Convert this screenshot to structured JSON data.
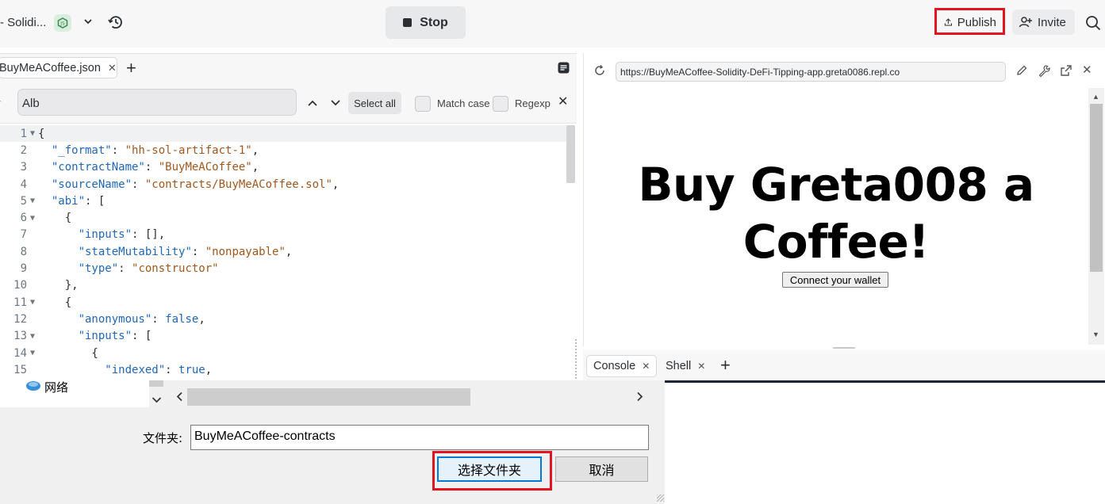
{
  "topbar": {
    "project_title": "- Solidi...",
    "stop_label": "Stop",
    "publish_label": "Publish",
    "invite_label": "Invite"
  },
  "editor": {
    "tab_label": "BuyMeACoffee.json",
    "find_value": "Alb",
    "select_all_label": "Select all",
    "match_case_label": "Match case",
    "regexp_label": "Regexp",
    "lines": [
      {
        "n": "1",
        "fold": true,
        "tokens": [
          [
            "p",
            "{"
          ]
        ]
      },
      {
        "n": "2",
        "fold": false,
        "tokens": [
          [
            "p",
            "  "
          ],
          [
            "key",
            "\"_format\""
          ],
          [
            "p",
            ": "
          ],
          [
            "str",
            "\"hh-sol-artifact-1\""
          ],
          [
            "p",
            ","
          ]
        ]
      },
      {
        "n": "3",
        "fold": false,
        "tokens": [
          [
            "p",
            "  "
          ],
          [
            "key",
            "\"contractName\""
          ],
          [
            "p",
            ": "
          ],
          [
            "str",
            "\"BuyMeACoffee\""
          ],
          [
            "p",
            ","
          ]
        ]
      },
      {
        "n": "4",
        "fold": false,
        "tokens": [
          [
            "p",
            "  "
          ],
          [
            "key",
            "\"sourceName\""
          ],
          [
            "p",
            ": "
          ],
          [
            "str",
            "\"contracts/BuyMeACoffee.sol\""
          ],
          [
            "p",
            ","
          ]
        ]
      },
      {
        "n": "5",
        "fold": true,
        "tokens": [
          [
            "p",
            "  "
          ],
          [
            "key",
            "\"abi\""
          ],
          [
            "p",
            ": ["
          ]
        ]
      },
      {
        "n": "6",
        "fold": true,
        "tokens": [
          [
            "p",
            "    {"
          ]
        ]
      },
      {
        "n": "7",
        "fold": false,
        "tokens": [
          [
            "p",
            "      "
          ],
          [
            "key",
            "\"inputs\""
          ],
          [
            "p",
            ": [],"
          ]
        ]
      },
      {
        "n": "8",
        "fold": false,
        "tokens": [
          [
            "p",
            "      "
          ],
          [
            "key",
            "\"stateMutability\""
          ],
          [
            "p",
            ": "
          ],
          [
            "str",
            "\"nonpayable\""
          ],
          [
            "p",
            ","
          ]
        ]
      },
      {
        "n": "9",
        "fold": false,
        "tokens": [
          [
            "p",
            "      "
          ],
          [
            "key",
            "\"type\""
          ],
          [
            "p",
            ": "
          ],
          [
            "str",
            "\"constructor\""
          ]
        ]
      },
      {
        "n": "10",
        "fold": false,
        "tokens": [
          [
            "p",
            "    },"
          ]
        ]
      },
      {
        "n": "11",
        "fold": true,
        "tokens": [
          [
            "p",
            "    {"
          ]
        ]
      },
      {
        "n": "12",
        "fold": false,
        "tokens": [
          [
            "p",
            "      "
          ],
          [
            "key",
            "\"anonymous\""
          ],
          [
            "p",
            ": "
          ],
          [
            "kw",
            "false"
          ],
          [
            "p",
            ","
          ]
        ]
      },
      {
        "n": "13",
        "fold": true,
        "tokens": [
          [
            "p",
            "      "
          ],
          [
            "key",
            "\"inputs\""
          ],
          [
            "p",
            ": ["
          ]
        ]
      },
      {
        "n": "14",
        "fold": true,
        "tokens": [
          [
            "p",
            "        {"
          ]
        ]
      },
      {
        "n": "15",
        "fold": false,
        "tokens": [
          [
            "p",
            "          "
          ],
          [
            "key",
            "\"indexed\""
          ],
          [
            "p",
            ": "
          ],
          [
            "kw",
            "true"
          ],
          [
            "p",
            ","
          ]
        ]
      }
    ]
  },
  "webview": {
    "url": "https://BuyMeACoffee-Solidity-DeFi-Tipping-app.greta0086.repl.co",
    "headline_line1": "Buy Greta008 a",
    "headline_line2": "Coffee!",
    "connect_label": "Connect your wallet"
  },
  "console": {
    "tab_console": "Console",
    "tab_shell": "Shell"
  },
  "dialog": {
    "tree_item_label": "网络",
    "folder_label": "文件夹:",
    "folder_value": "BuyMeACoffee-contracts",
    "select_folder_label": "选择文件夹",
    "cancel_label": "取消"
  },
  "colors": {
    "highlight_red": "#e0151f",
    "key_blue": "#2167b8",
    "string_brown": "#a0571d"
  }
}
